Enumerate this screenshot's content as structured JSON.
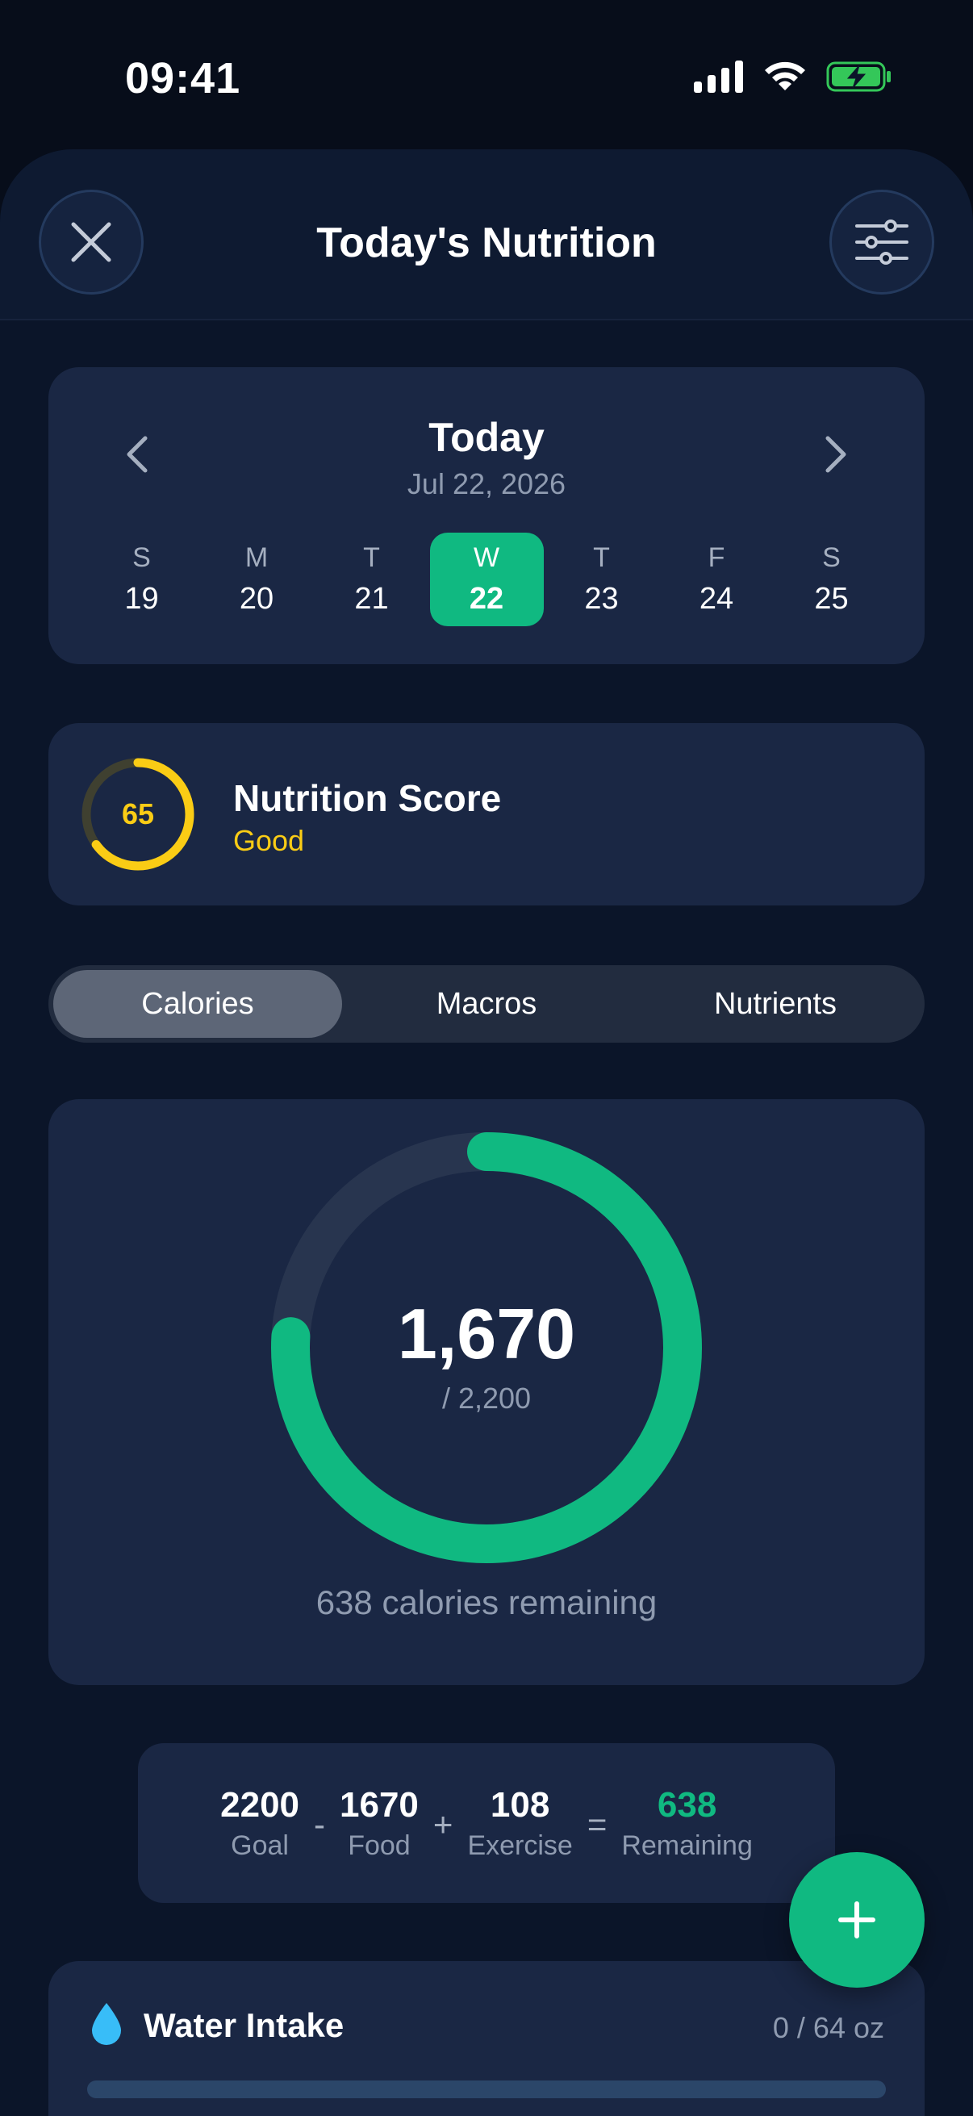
{
  "status_bar": {
    "time": "09:41"
  },
  "header": {
    "title": "Today's Nutrition"
  },
  "date_picker": {
    "title": "Today",
    "date": "Jul 22, 2026",
    "days": [
      {
        "letter": "S",
        "num": "19",
        "selected": false
      },
      {
        "letter": "M",
        "num": "20",
        "selected": false
      },
      {
        "letter": "T",
        "num": "21",
        "selected": false
      },
      {
        "letter": "W",
        "num": "22",
        "selected": true
      },
      {
        "letter": "T",
        "num": "23",
        "selected": false
      },
      {
        "letter": "F",
        "num": "24",
        "selected": false
      },
      {
        "letter": "S",
        "num": "25",
        "selected": false
      }
    ]
  },
  "nutrition_score": {
    "value": "65",
    "title": "Nutrition Score",
    "status": "Good",
    "color": "#facc15"
  },
  "tabs": [
    {
      "label": "Calories",
      "active": true
    },
    {
      "label": "Macros",
      "active": false
    },
    {
      "label": "Nutrients",
      "active": false
    }
  ],
  "calories": {
    "consumed": "1,670",
    "goal": "/ 2,200",
    "remaining_text": "638 calories remaining",
    "progress": 0.759,
    "color": "#10b981"
  },
  "formula": {
    "goal_value": "2200",
    "goal_label": "Goal",
    "op_minus": "-",
    "food_value": "1670",
    "food_label": "Food",
    "op_plus": "+",
    "exercise_value": "108",
    "exercise_label": "Exercise",
    "op_equals": "=",
    "remaining_value": "638",
    "remaining_label": "Remaining"
  },
  "water": {
    "title": "Water Intake",
    "amount": "0 / 64 oz",
    "progress": 0
  },
  "icons": {
    "close": "close-icon",
    "settings": "sliders-icon",
    "prev": "chevron-left-icon",
    "next": "chevron-right-icon",
    "add": "plus-icon",
    "water": "water-drop-icon"
  }
}
